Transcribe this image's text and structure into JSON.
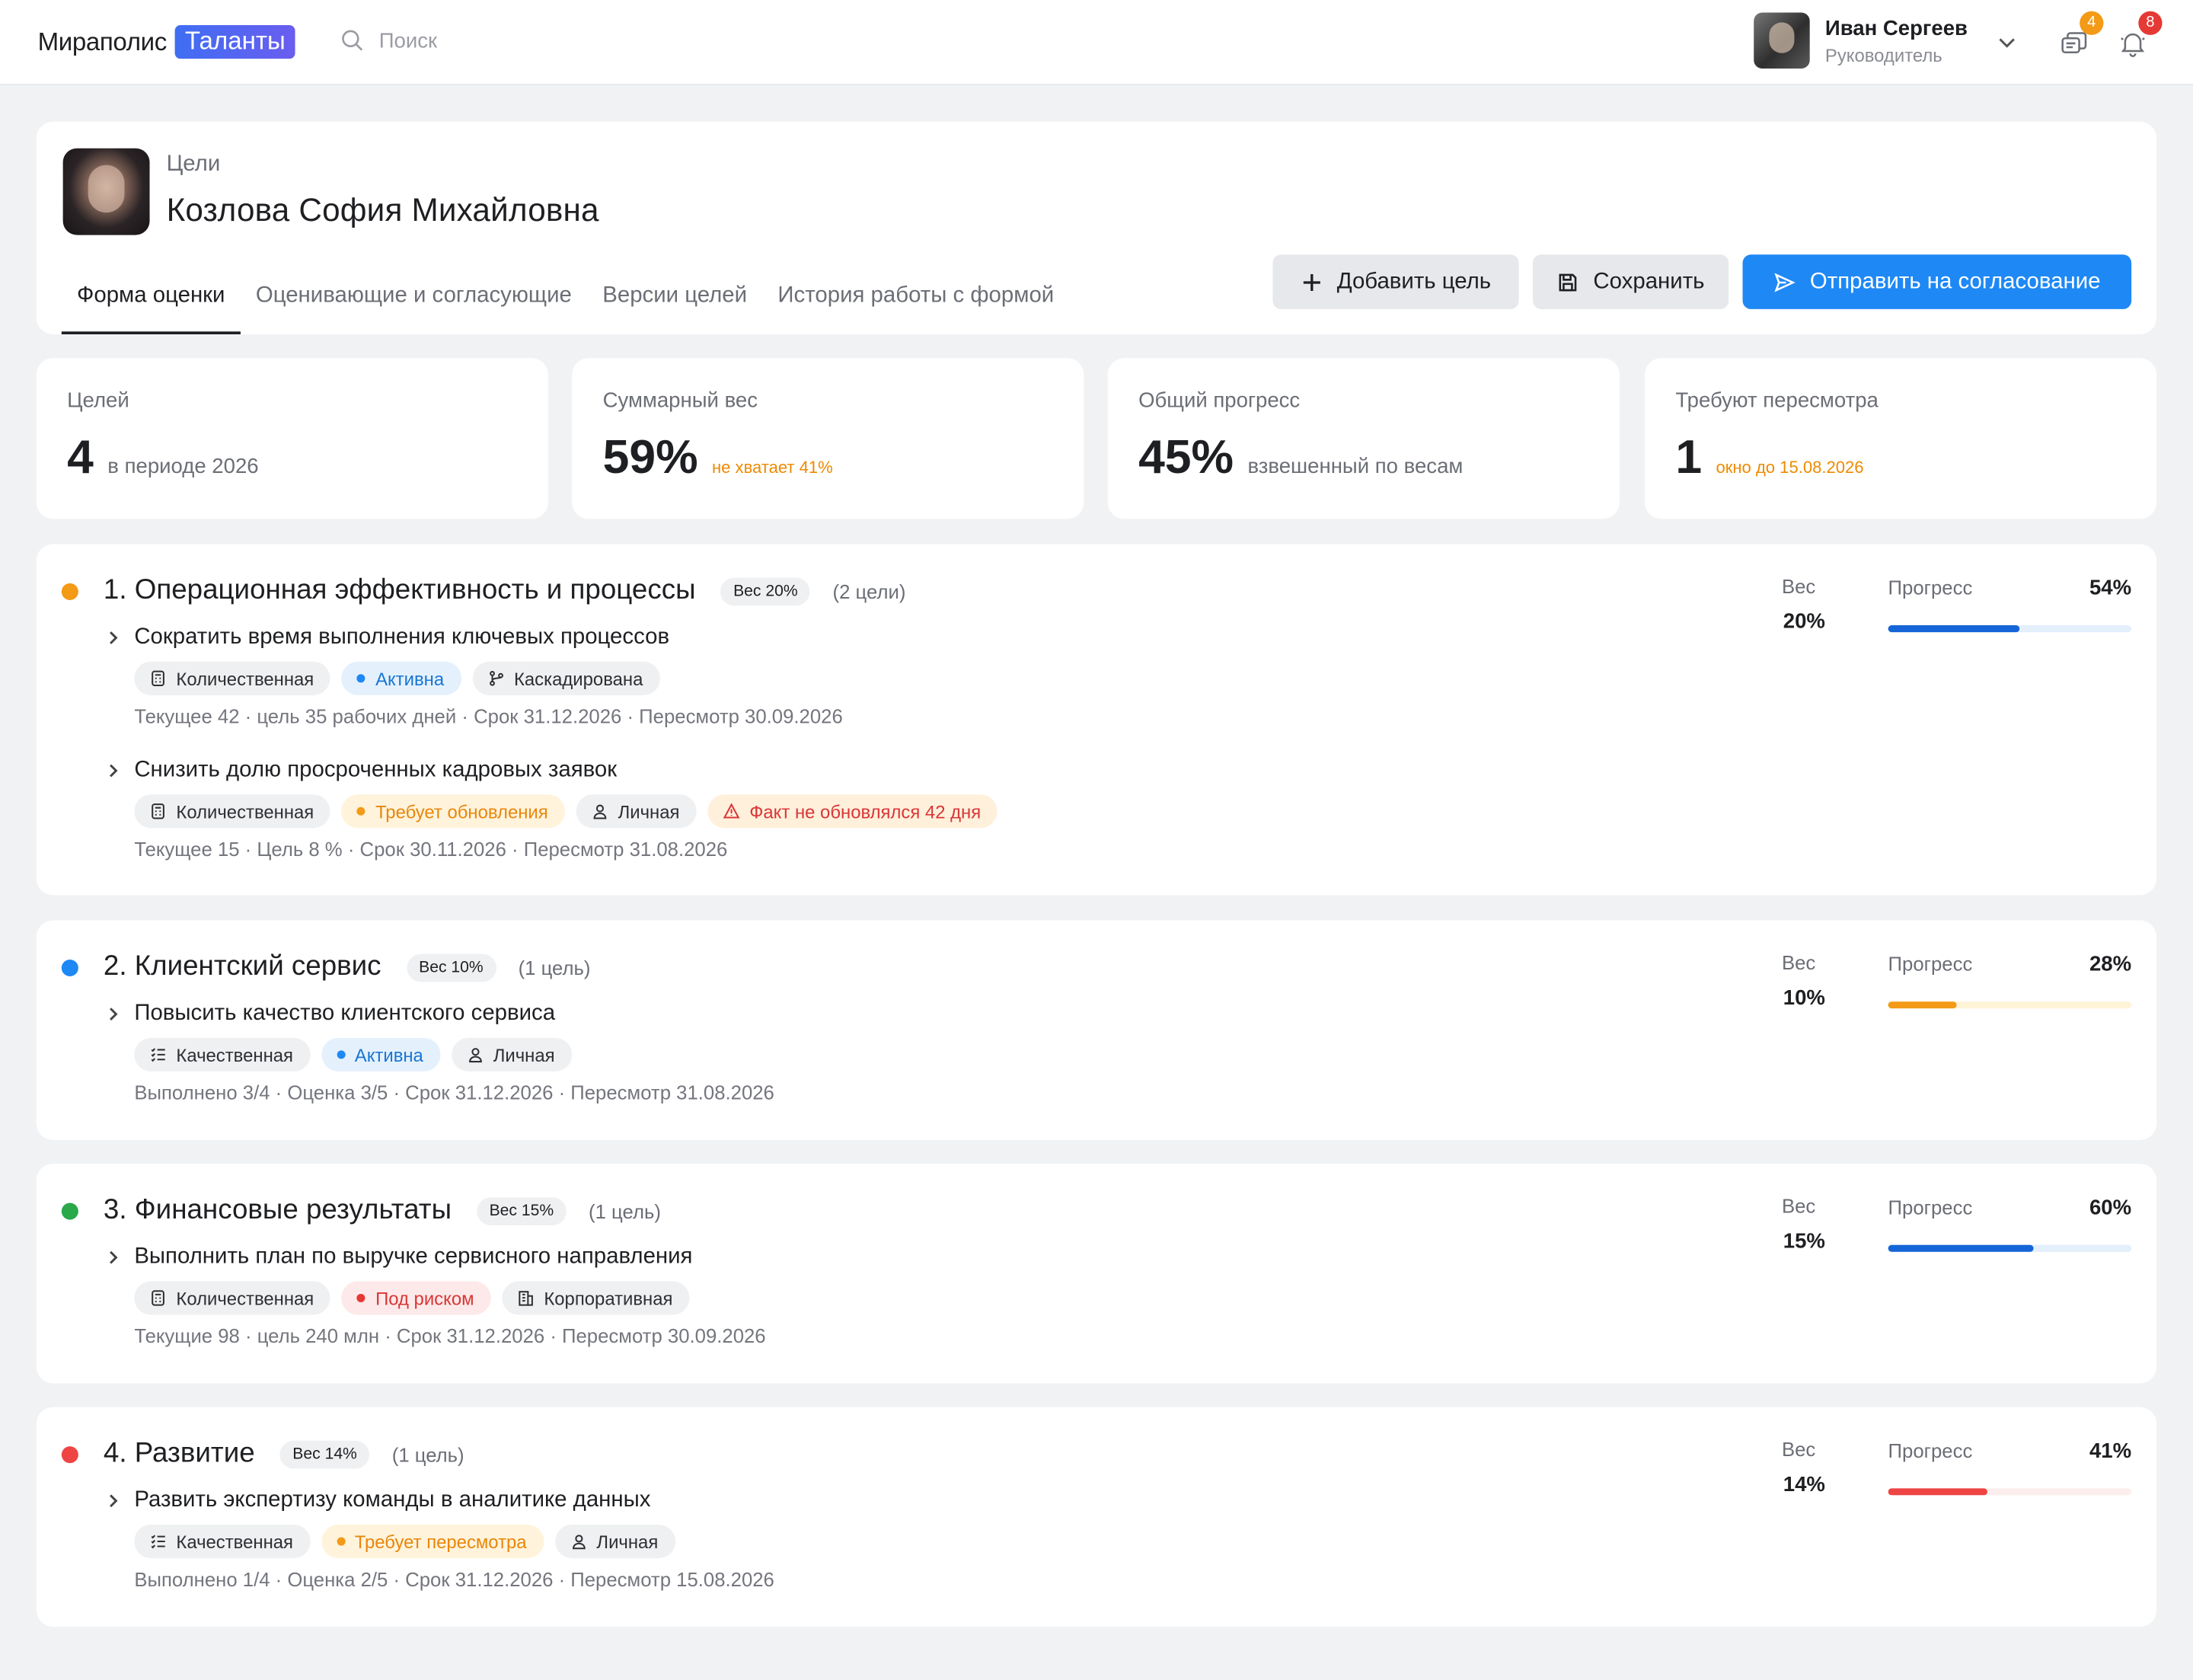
{
  "header": {
    "brand_name": "Мираполис",
    "brand_pill": "Таланты",
    "search_placeholder": "Поиск",
    "user": {
      "name": "Иван Сергеев",
      "role": "Руководитель"
    },
    "messages_badge": "4",
    "notifications_badge": "8",
    "colors": {
      "messages_badge": "#f39a16",
      "notifications_badge": "#e53935"
    }
  },
  "profile": {
    "caption": "Цели",
    "name": "Козлова София Михайловна",
    "tabs": [
      "Форма оценки",
      "Оценивающие и согласующие",
      "Версии целей",
      "История работы с формой"
    ],
    "active_tab": 0,
    "buttons": {
      "add": "Добавить цель",
      "save": "Сохранить",
      "send": "Отправить на согласование"
    }
  },
  "stats": [
    {
      "label": "Целей",
      "value": "4",
      "sub": "в периоде 2026",
      "sub_type": "muted"
    },
    {
      "label": "Суммарный вес",
      "value": "59%",
      "sub": "не хватает 41%",
      "sub_type": "warn"
    },
    {
      "label": "Общий прогресс",
      "value": "45%",
      "sub": "взвешенный по весам",
      "sub_type": "muted"
    },
    {
      "label": "Требуют пересмотра",
      "value": "1",
      "sub": "окно до 15.08.2026",
      "sub_type": "warn"
    }
  ],
  "labels": {
    "weight": "Вес",
    "progress": "Прогресс"
  },
  "groups": [
    {
      "title": "1. Операционная эффективность и процессы",
      "weight_badge": "Вес 20%",
      "count": "(2 цели)",
      "dot_color": "#f39a16",
      "weight": "20%",
      "progress": "54%",
      "progress_value": 54,
      "bar_color": "#1565d8",
      "track_color": "#e3effb",
      "goals": [
        {
          "title": "Сократить время выполнения ключевых процессов",
          "chips": [
            {
              "label": "Количественная",
              "kind": "gray",
              "icon": "calculator-icon"
            },
            {
              "label": "Активна",
              "kind": "blue",
              "icon": "dot"
            },
            {
              "label": "Каскадирована",
              "kind": "gray",
              "icon": "branch-icon"
            }
          ],
          "meta": "Текущее 42 · цель 35 рабочих дней · Срок 31.12.2026 · Пересмотр 30.09.2026"
        },
        {
          "title": "Снизить долю просроченных кадровых заявок",
          "chips": [
            {
              "label": "Количественная",
              "kind": "gray",
              "icon": "calculator-icon"
            },
            {
              "label": "Требует обновления",
              "kind": "orange",
              "icon": "dot"
            },
            {
              "label": "Личная",
              "kind": "gray",
              "icon": "person-icon"
            },
            {
              "label": "Факт не обновлялся 42 дня",
              "kind": "warnred",
              "icon": "warning-icon"
            }
          ],
          "meta": "Текущее 15 · Цель 8 % · Срок 30.11.2026 · Пересмотр 31.08.2026"
        }
      ]
    },
    {
      "title": "2. Клиентский сервис",
      "weight_badge": "Вес 10%",
      "count": "(1 цель)",
      "dot_color": "#1e88f5",
      "weight": "10%",
      "progress": "28%",
      "progress_value": 28,
      "bar_color": "#f39a16",
      "track_color": "#fff3d8",
      "goals": [
        {
          "title": "Повысить качество клиентского сервиса",
          "chips": [
            {
              "label": "Качественная",
              "kind": "gray",
              "icon": "checklist-icon"
            },
            {
              "label": "Активна",
              "kind": "blue",
              "icon": "dot"
            },
            {
              "label": "Личная",
              "kind": "gray",
              "icon": "person-icon"
            }
          ],
          "meta": "Выполнено 3/4 · Оценка 3/5 · Срок 31.12.2026 · Пересмотр 31.08.2026"
        }
      ]
    },
    {
      "title": "3. Финансовые результаты",
      "weight_badge": "Вес 15%",
      "count": "(1 цель)",
      "dot_color": "#2aa84a",
      "weight": "15%",
      "progress": "60%",
      "progress_value": 60,
      "bar_color": "#1565d8",
      "track_color": "#e3effb",
      "goals": [
        {
          "title": "Выполнить план по выручке сервисного направления",
          "chips": [
            {
              "label": "Количественная",
              "kind": "gray",
              "icon": "calculator-icon"
            },
            {
              "label": "Под риском",
              "kind": "red",
              "icon": "dot"
            },
            {
              "label": "Корпоративная",
              "kind": "gray",
              "icon": "building-icon"
            }
          ],
          "meta": "Текущие 98 · цель 240 млн · Срок 31.12.2026 · Пересмотр 30.09.2026"
        }
      ]
    },
    {
      "title": "4. Развитие",
      "weight_badge": "Вес 14%",
      "count": "(1 цель)",
      "dot_color": "#ef4444",
      "weight": "14%",
      "progress": "41%",
      "progress_value": 41,
      "bar_color": "#ef4444",
      "track_color": "#fdeeee",
      "goals": [
        {
          "title": "Развить экспертизу команды в аналитике данных",
          "chips": [
            {
              "label": "Качественная",
              "kind": "gray",
              "icon": "checklist-icon"
            },
            {
              "label": "Требует пересмотра",
              "kind": "orange",
              "icon": "dot"
            },
            {
              "label": "Личная",
              "kind": "gray",
              "icon": "person-icon"
            }
          ],
          "meta": "Выполнено 1/4 · Оценка 2/5 · Срок 31.12.2026 · Пересмотр 15.08.2026"
        }
      ]
    }
  ]
}
